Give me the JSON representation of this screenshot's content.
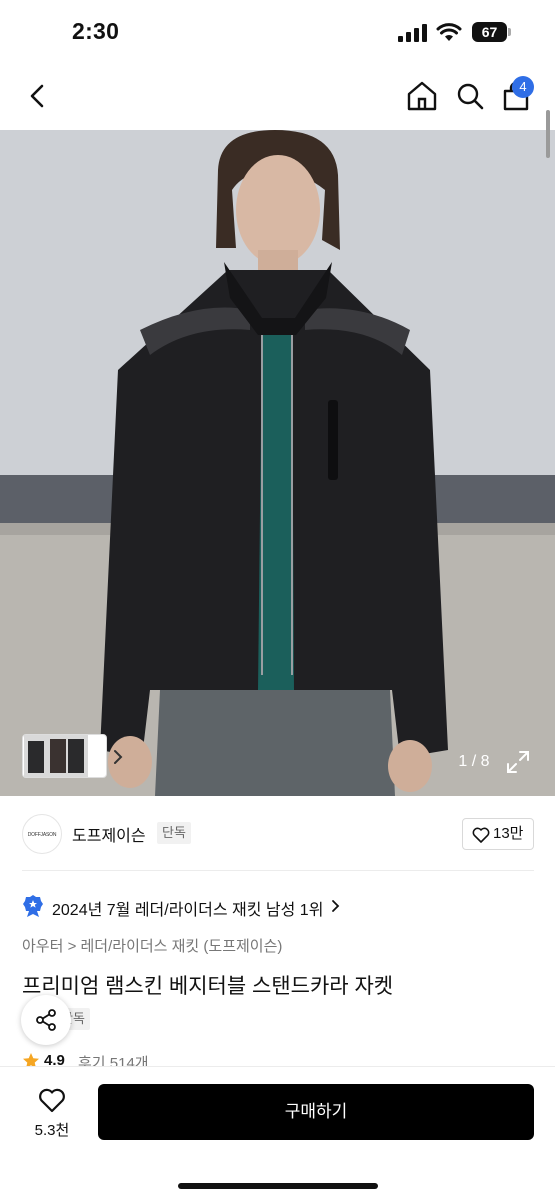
{
  "status_bar": {
    "time": "2:30",
    "battery": "67"
  },
  "nav": {
    "cart_count": "4"
  },
  "gallery": {
    "page_indicator": "1 / 8"
  },
  "brand": {
    "logo_text": "DOFFJASON",
    "name": "도프제이슨",
    "exclusive": "단독",
    "likes": "13만"
  },
  "ranking": {
    "text": "2024년 7월 레더/라이더스 재킷 남성 1위"
  },
  "product": {
    "breadcrumb": "아우터 > 레더/라이더스 재킷 (도프제이슨)",
    "title": "프리미엄 램스킨 베지터블 스탠드카라 자켓",
    "tag": "단독",
    "rating": "4.9",
    "reviews": "후기 514개"
  },
  "bottom": {
    "wish_count": "5.3천",
    "buy_label": "구매하기"
  },
  "colors": {
    "accent_blue": "#2f6ee6",
    "star": "#f5a623",
    "buy_button": "#000000"
  },
  "icons": [
    "back-icon",
    "home-icon",
    "search-icon",
    "bag-icon",
    "expand-icon",
    "heart-icon",
    "medal-icon",
    "share-icon",
    "star-icon"
  ]
}
